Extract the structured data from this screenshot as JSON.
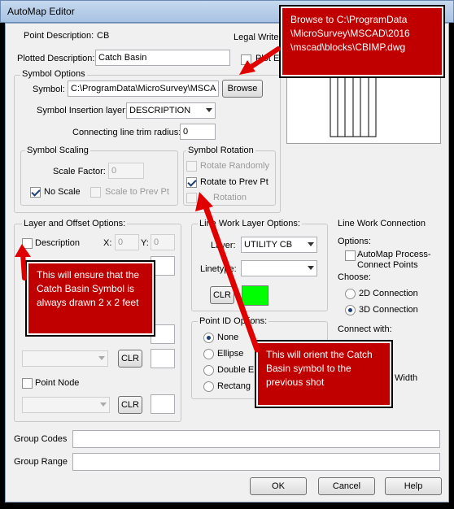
{
  "window": {
    "title": "AutoMap Editor"
  },
  "point_description": {
    "label": "Point Description:",
    "value": "CB"
  },
  "legal_writer": {
    "label": "Legal Write"
  },
  "plotted_description": {
    "label": "Plotted Description:",
    "value": "Catch Basin"
  },
  "plot_ex": {
    "label": "Plot Ex"
  },
  "symbol_options": {
    "legend": "Symbol Options",
    "symbol_label": "Symbol:",
    "symbol_value": "C:\\ProgramData\\MicroSurvey\\MSCA",
    "browse": "Browse",
    "insertion_layer_label": "Symbol Insertion layer:",
    "insertion_layer_value": "DESCRIPTION",
    "trim_radius_label": "Connecting line trim radius:",
    "trim_radius_value": "0"
  },
  "symbol_scaling": {
    "legend": "Symbol Scaling",
    "scale_factor_label": "Scale Factor:",
    "scale_factor_value": "0",
    "no_scale": "No Scale",
    "scale_to_prev": "Scale to Prev Pt"
  },
  "symbol_rotation": {
    "legend": "Symbol Rotation",
    "rotate_randomly": "Rotate Randomly",
    "rotate_to_prev": "Rotate to Prev Pt",
    "rotation": "Rotation"
  },
  "layer_offset": {
    "legend": "Layer and Offset Options:",
    "description": "Description",
    "x_label": "X:",
    "x_value": "0",
    "y_label": "Y:",
    "y_value": "0",
    "clr": "CLR",
    "point_node": "Point Node"
  },
  "line_work_layer": {
    "legend": "Line Work Layer Options:",
    "layer_label": "Layer:",
    "layer_value": "UTILITY CB",
    "linetype_label": "Linetype:",
    "linetype_value": "",
    "clr": "CLR",
    "color": "#00ff00"
  },
  "point_id": {
    "legend": "Point ID Options:",
    "options": [
      "None",
      "Ellipse",
      "Double E",
      "Rectang"
    ]
  },
  "line_work_connection": {
    "legend": "Line Work Connection",
    "options_label": "Options:",
    "automap_process": "AutoMap Process-Connect Points",
    "choose_label": "Choose:",
    "connection_2d": "2D Connection",
    "connection_3d": "3D Connection",
    "connect_with_label": "Connect with:",
    "width_label": "Width"
  },
  "group_codes": {
    "label": "Group Codes",
    "value": ""
  },
  "group_range": {
    "label": "Group Range",
    "value": ""
  },
  "buttons": {
    "ok": "OK",
    "cancel": "Cancel",
    "help": "Help"
  },
  "callouts": {
    "browse_note": "Browse to C:\\ProgramData\n\\MicroSurvey\\MSCAD\\2016\n\\mscad\\blocks\\CBIMP.dwg",
    "scale_note": "This will ensure that the Catch Basin Symbol is always drawn 2 x 2 feet",
    "rotate_note": "This will orient the Catch Basin symbol to the previous shot"
  },
  "colors": {
    "callout": "#c00000",
    "arrow": "#e00000"
  },
  "icons": {
    "arrow": "red-arrow-icon"
  }
}
